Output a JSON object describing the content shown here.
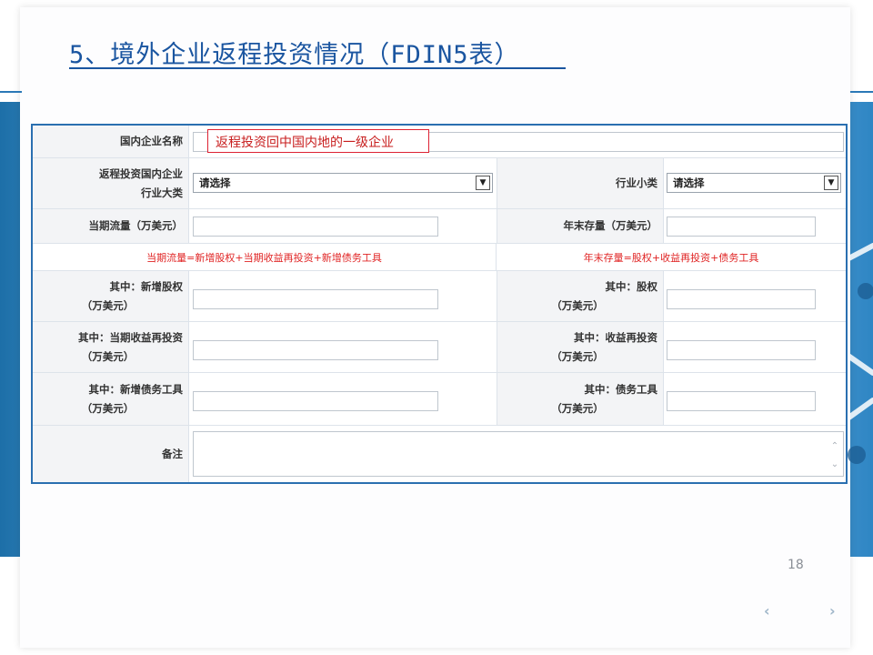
{
  "slide": {
    "title": "5、境外企业返程投资情况（FDIN5表）",
    "page_number": "18",
    "nav_prev": "‹",
    "nav_next": "›"
  },
  "form": {
    "company_name_label": "国内企业名称",
    "company_name_hint": "返程投资回中国内地的一级企业",
    "category_label_line1": "返程投资国内企业",
    "category_label_line2": "行业大类",
    "category_value": "请选择",
    "subcategory_label": "行业小类",
    "subcategory_value": "请选择",
    "flow_label": "当期流量（万美元）",
    "stock_label": "年末存量（万美元）",
    "flow_formula": "当期流量=新增股权+当期收益再投资+新增债务工具",
    "stock_formula": "年末存量=股权+收益再投资+债务工具",
    "new_equity_label": "其中：新增股权",
    "equity_label": "其中：股权",
    "reinvest_flow_label": "其中：当期收益再投资",
    "reinvest_stock_label": "其中：收益再投资",
    "new_debt_label": "其中：新增债务工具",
    "debt_label": "其中：债务工具",
    "unit": "（万美元）",
    "remarks_label": "备注"
  }
}
